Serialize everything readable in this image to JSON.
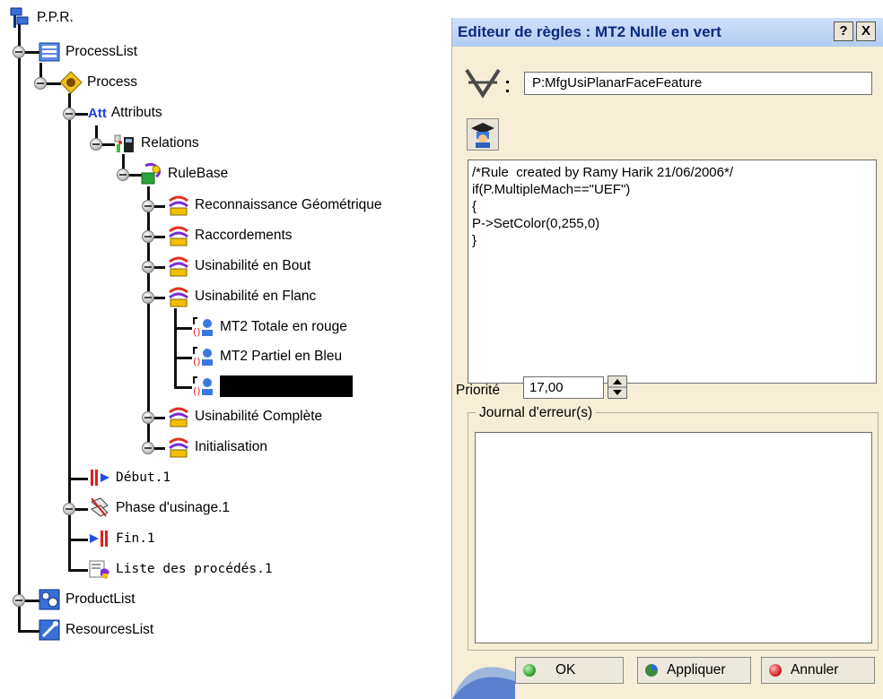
{
  "tree": {
    "root": "P.P.R.",
    "process_list": "ProcessList",
    "process": "Process",
    "attributs": "Attributs",
    "relations": "Relations",
    "rulebase": "RuleBase",
    "rule_sets": [
      "Reconnaissance Géométrique",
      "Raccordements",
      "Usinabilité en Bout",
      "Usinabilité en Flanc"
    ],
    "flanc_rules": [
      "MT2 Totale en rouge",
      "MT2 Partiel en Bleu"
    ],
    "rule_sets_after": [
      "Usinabilité Complète",
      "Initialisation"
    ],
    "debut": "Début.1",
    "phase": "Phase d'usinage.1",
    "fin": "Fin.1",
    "liste": "Liste des procédés.1",
    "product_list": "ProductList",
    "resources_list": "ResourcesList",
    "att_badge": "Att"
  },
  "dialog": {
    "title": "Editeur de règles : MT2 Nulle en vert",
    "help_btn": "?",
    "close_btn": "X",
    "filter_value": "P:MfgUsiPlanarFaceFeature",
    "rule_code": "/*Rule  created by Ramy Harik 21/06/2006*/\nif(P.MultipleMach==\"UEF\")\n{\nP->SetColor(0,255,0)\n}",
    "priority_label": "Priorité",
    "priority_value": "17,00",
    "journal_label": "Journal d'erreur(s)",
    "journal_text": "",
    "ok_label": "OK",
    "apply_label": "Appliquer",
    "cancel_label": "Annuler"
  },
  "colors": {
    "dialog_bg": "#f6eed7",
    "title_text": "#0a2a7c",
    "ok_dot": "#2fa12f",
    "apply_dot": "#3b8a3b",
    "cancel_dot": "#cc2222"
  }
}
